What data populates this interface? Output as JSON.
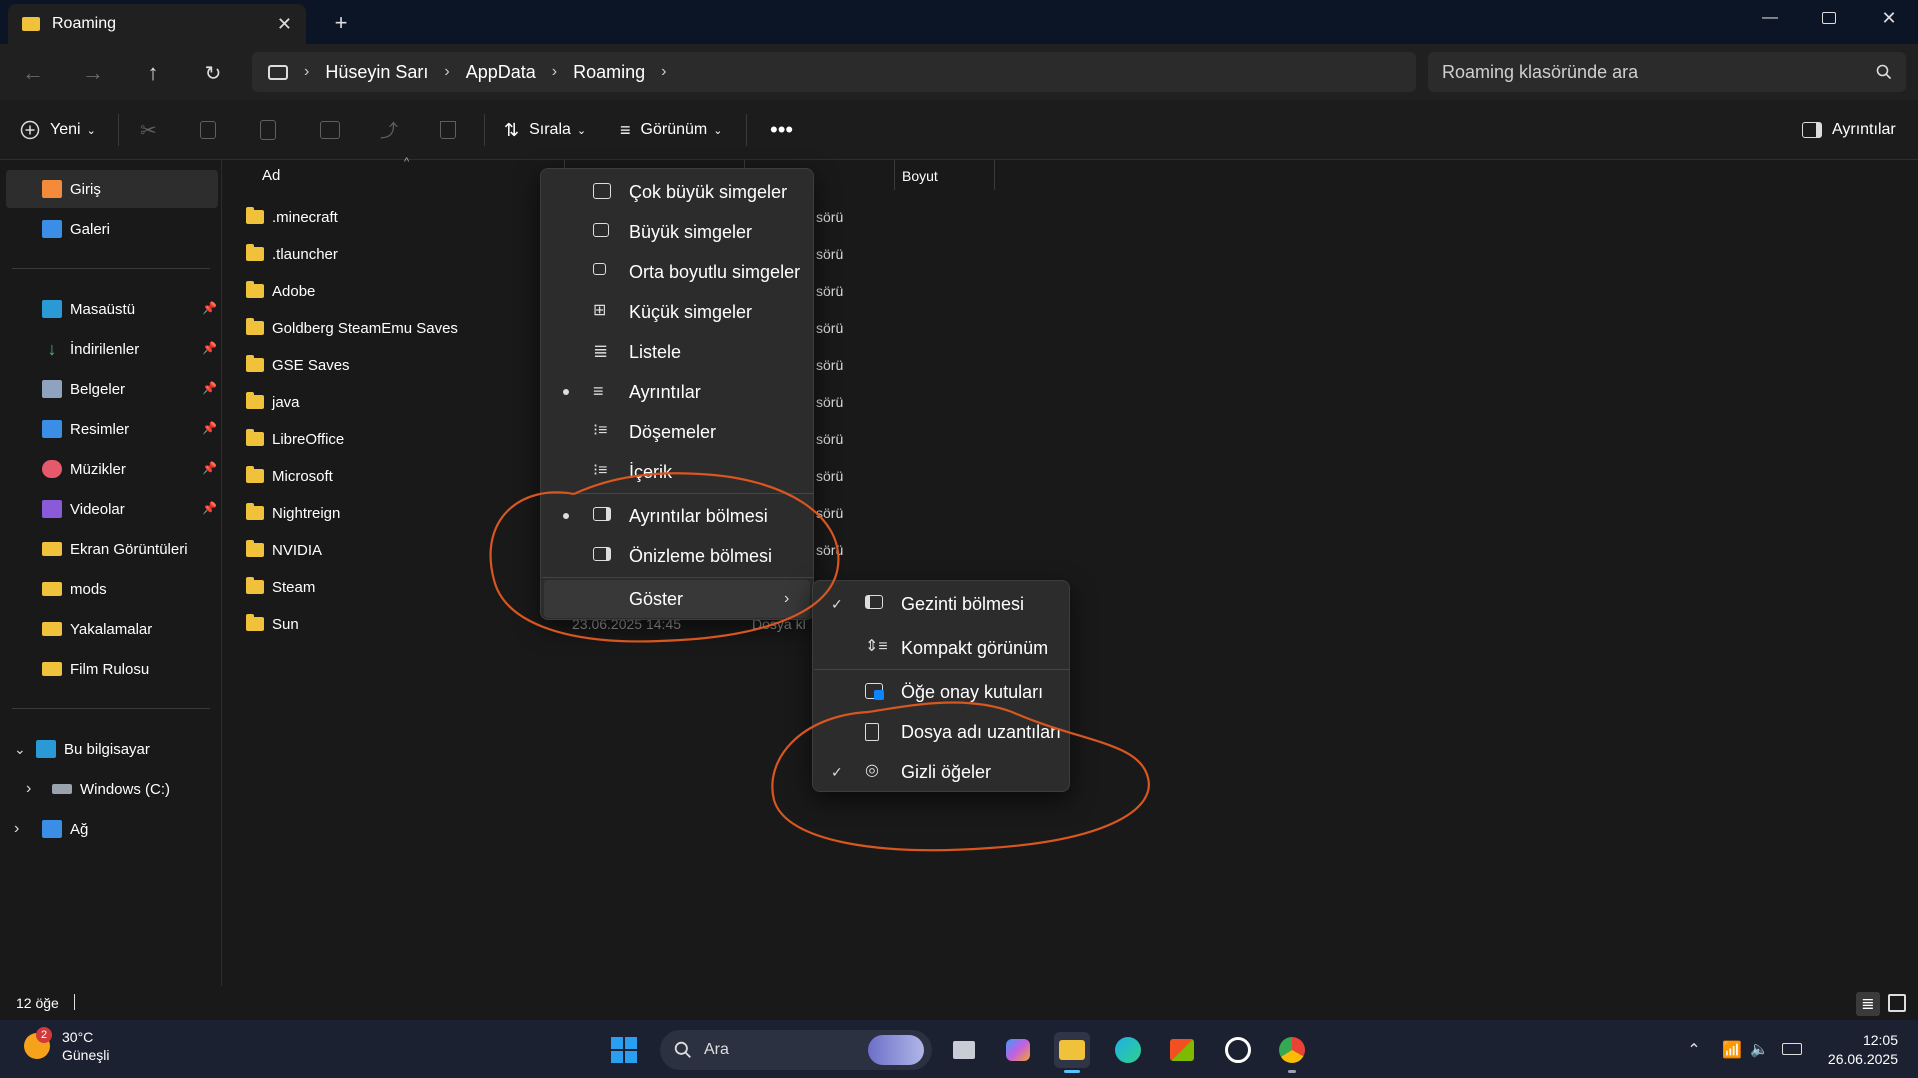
{
  "window": {
    "tab_title": "Roaming"
  },
  "breadcrumb": {
    "items": [
      "Hüseyin Sarı",
      "AppData",
      "Roaming"
    ]
  },
  "search": {
    "placeholder": "Roaming klasöründe ara"
  },
  "toolbar": {
    "new_label": "Yeni",
    "sort_label": "Sırala",
    "view_label": "Görünüm",
    "details_label": "Ayrıntılar"
  },
  "sidebar": {
    "top_items": [
      "Giriş",
      "Galeri"
    ],
    "pinned_items": [
      "Masaüstü",
      "İndirilenler",
      "Belgeler",
      "Resimler",
      "Müzikler",
      "Videolar"
    ],
    "folders": [
      "Ekran Görüntüleri",
      "mods",
      "Yakalamalar",
      "Film Rulosu"
    ],
    "this_pc": "Bu bilgisayar",
    "drive": "Windows (C:)",
    "network": "Ağ"
  },
  "file_list": {
    "col_name": "Ad",
    "col_size": "Boyut",
    "files": [
      ".minecraft",
      ".tlauncher",
      "Adobe",
      "Goldberg SteamEmu Saves",
      "GSE Saves",
      "java",
      "LibreOffice",
      "Microsoft",
      "Nightreign",
      "NVIDIA",
      "Steam",
      "Sun"
    ],
    "type_fragment": "sörü",
    "last_date": "23.06.2025 14:45",
    "last_type": "Dosya kl"
  },
  "view_menu": {
    "items": [
      "Çok büyük simgeler",
      "Büyük simgeler",
      "Orta boyutlu simgeler",
      "Küçük simgeler",
      "Listele",
      "Ayrıntılar",
      "Döşemeler",
      "İçerik"
    ],
    "panes": [
      "Ayrıntılar bölmesi",
      "Önizleme bölmesi"
    ],
    "show": "Göster"
  },
  "show_submenu": {
    "items": [
      "Gezinti bölmesi",
      "Kompakt görünüm",
      "Öğe onay kutuları",
      "Dosya adı uzantıları",
      "Gizli öğeler"
    ]
  },
  "status": {
    "count": "12 öğe"
  },
  "taskbar": {
    "temp": "30°C",
    "weather": "Güneşli",
    "badge": "2",
    "search": "Ara",
    "time": "12:05",
    "date": "26.06.2025"
  },
  "colors": {
    "accent": "#0a84ff",
    "folder": "#f0c23b",
    "annotation": "#d8561f"
  }
}
